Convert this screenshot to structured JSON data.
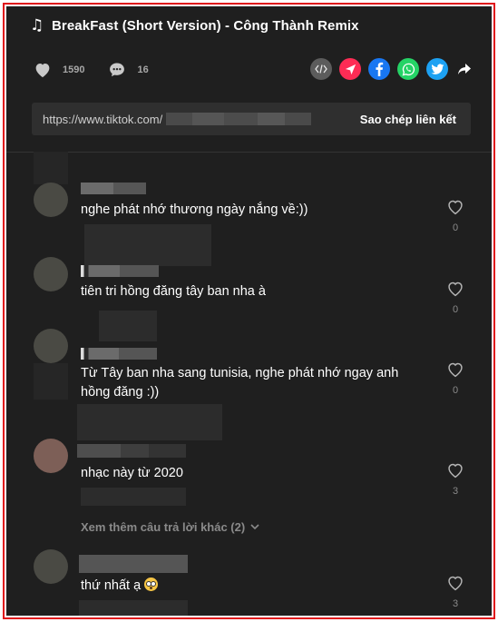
{
  "song": {
    "title": "BreakFast (Short Version) - Công Thành Remix",
    "icon": "music-note-icon"
  },
  "stats": {
    "likes": "1590",
    "comments": "16"
  },
  "share": {
    "buttons": [
      {
        "name": "embed",
        "color": "#5c5c5c"
      },
      {
        "name": "send",
        "color": "#fe2c55"
      },
      {
        "name": "facebook",
        "color": "#1877f2"
      },
      {
        "name": "whatsapp",
        "color": "#25d366"
      },
      {
        "name": "twitter",
        "color": "#1da1f2"
      },
      {
        "name": "share-more",
        "color": "#ffffff"
      }
    ]
  },
  "link": {
    "url": "https://www.tiktok.com/",
    "copy_label": "Sao chép liên kết"
  },
  "comments": [
    {
      "text": "nghe phát nhớ thương ngày nắng về:))",
      "likes": "0"
    },
    {
      "text": "tiên tri hồng đăng tây ban nha à",
      "likes": "0"
    },
    {
      "text": "Từ Tây ban nha sang tunisia, nghe phát nhớ ngay anh hồng đăng :))",
      "likes": "0"
    },
    {
      "text": "nhạc này từ 2020",
      "likes": "3"
    },
    {
      "text": "thứ nhất ạ",
      "likes": "3"
    }
  ],
  "more_replies": "Xem thêm câu trả lời khác (2)",
  "colors": {
    "background": "#1f1f1f",
    "text": "#ffffff",
    "muted": "#8a8a8a",
    "frame": "#e0121b"
  }
}
